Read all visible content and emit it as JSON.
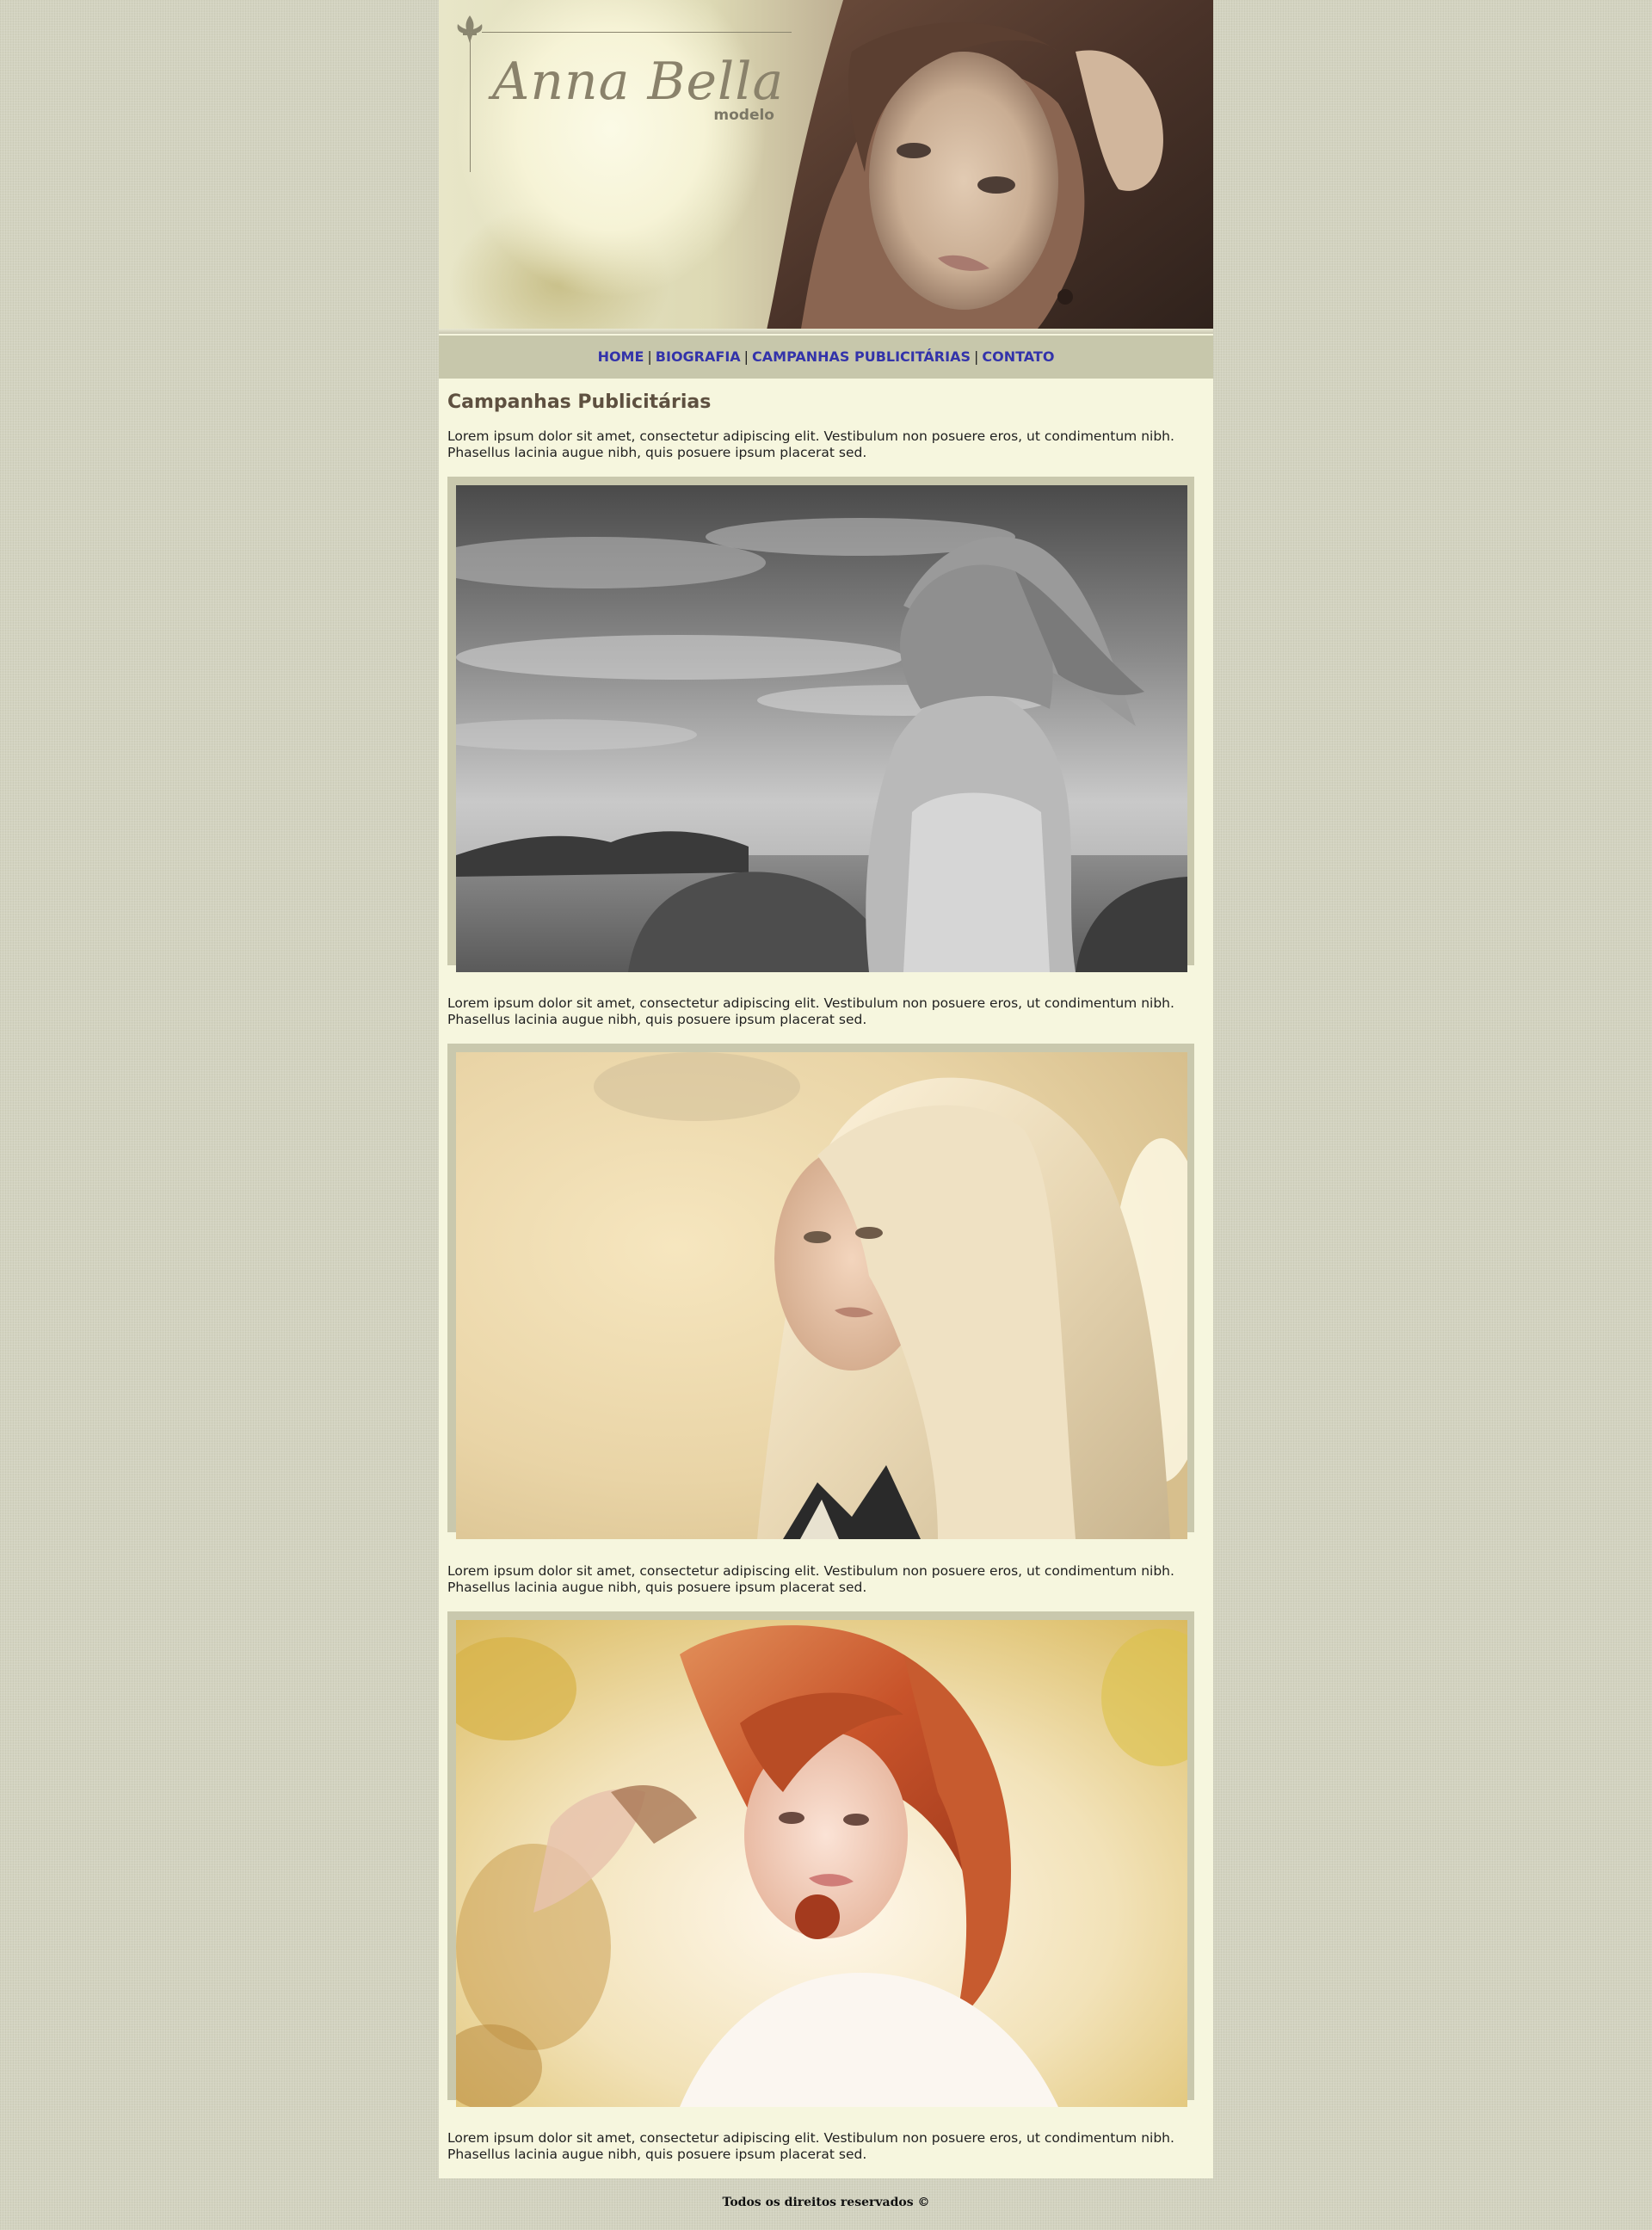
{
  "header": {
    "logo_name": "Anna Bella",
    "logo_sub": "modelo"
  },
  "nav": {
    "items": [
      {
        "label": "HOME"
      },
      {
        "label": "BIOGRAFIA"
      },
      {
        "label": "CAMPANHAS PUBLICITÁRIAS"
      },
      {
        "label": "CONTATO"
      }
    ],
    "separator": "|"
  },
  "main": {
    "title": "Campanhas Publicitárias",
    "paragraphs": [
      "Lorem ipsum dolor sit amet, consectetur adipiscing elit. Vestibulum non posuere eros, ut condimentum nibh. Phasellus lacinia augue nibh, quis posuere ipsum placerat sed.",
      "Lorem ipsum dolor sit amet, consectetur adipiscing elit. Vestibulum non posuere eros, ut condimentum nibh. Phasellus lacinia augue nibh, quis posuere ipsum placerat sed.",
      "Lorem ipsum dolor sit amet, consectetur adipiscing elit. Vestibulum non posuere eros, ut condimentum nibh. Phasellus lacinia augue nibh, quis posuere ipsum placerat sed.",
      "Lorem ipsum dolor sit amet, consectetur adipiscing elit. Vestibulum non posuere eros, ut condimentum nibh. Phasellus lacinia augue nibh, quis posuere ipsum placerat sed."
    ]
  },
  "footer": {
    "text": "Todos os direitos reservados ©"
  },
  "colors": {
    "page_bg": "#d3d3c0",
    "content_bg": "#f6f6de",
    "nav_bg": "#c7c7ab",
    "nav_link": "#3333aa",
    "title": "#5e5040",
    "frame": "#c9c8ad"
  }
}
